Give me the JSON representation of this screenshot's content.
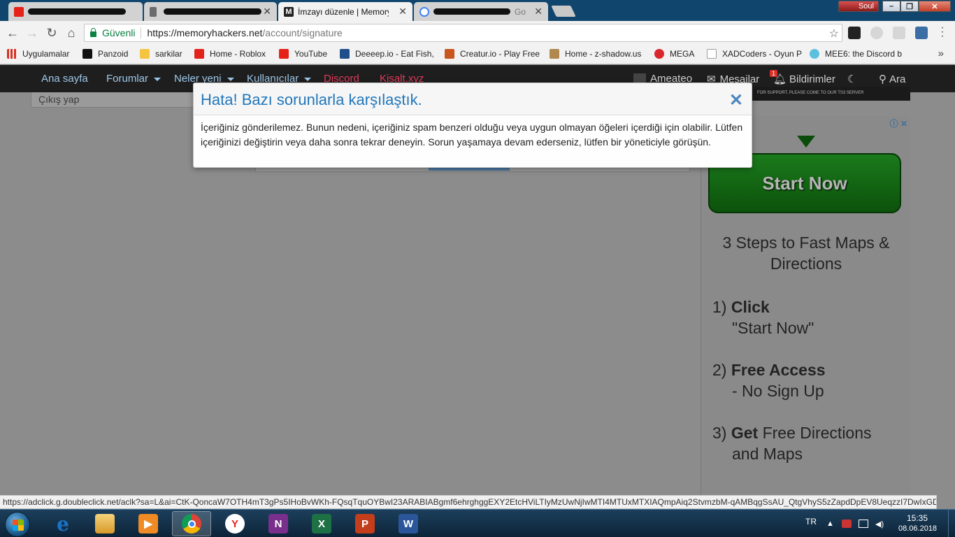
{
  "tabs": [
    {
      "title": "",
      "favicon_color": "#e62117"
    },
    {
      "title": "",
      "favicon_color": "#6b6b6b"
    },
    {
      "title": "İmzayı düzenle | Memory",
      "favicon_color": "#222222"
    },
    {
      "title": "Go",
      "favicon_color": "#4285f4"
    }
  ],
  "profile_name": "Soul",
  "address_bar": {
    "secure_label": "Güvenli",
    "url_host": "https://memoryhackers.net",
    "url_path": "/account/signature"
  },
  "bookmarks": [
    {
      "label": "Uygulamalar",
      "icon": "apps-grid-icon",
      "color": "#d93025"
    },
    {
      "label": "Panzoid",
      "icon": "panzoid-icon",
      "color": "#111111"
    },
    {
      "label": "sarkilar",
      "icon": "folder-icon",
      "color": "#f5c542"
    },
    {
      "label": "Home - Roblox",
      "icon": "roblox-icon",
      "color": "#e2231a"
    },
    {
      "label": "YouTube",
      "icon": "youtube-icon",
      "color": "#e62117"
    },
    {
      "label": "Deeeep.io - Eat Fish,",
      "icon": "deeeep-icon",
      "color": "#1e4f8a"
    },
    {
      "label": "Creatur.io - Play Free",
      "icon": "creatur-icon",
      "color": "#c8561e"
    },
    {
      "label": "Home - z-shadow.us",
      "icon": "zshadow-icon",
      "color": "#b08850"
    },
    {
      "label": "MEGA",
      "icon": "mega-icon",
      "color": "#d9272e"
    },
    {
      "label": "XADCoders - Oyun P",
      "icon": "page-icon",
      "color": "#9e9e9e"
    },
    {
      "label": "MEE6: the Discord b",
      "icon": "mee6-icon",
      "color": "#5bc0de"
    }
  ],
  "sitenav": {
    "items": [
      "Ana sayfa",
      "Forumlar",
      "Neler yeni",
      "Kullanıcılar"
    ],
    "red_items": [
      "Discord",
      "Kisalt.xyz"
    ],
    "username": "Ameateo",
    "messages": "Mesajlar",
    "notifications": "Bildirimler",
    "notification_count": "1",
    "search": "Ara"
  },
  "sidebar": {
    "logout": "Çıkış yap"
  },
  "banner_text": "FOR SUPPORT, PLEASE COME TO OUR TS3 SERVER",
  "modal": {
    "title": "Hata! Bazı sorunlarla karşılaştık.",
    "message": "İçeriğiniz gönderilemez. Bunun nedeni, içeriğiniz spam benzeri olduğu veya uygun olmayan öğeleri içerdiği için olabilir. Lütfen içeriğinizi değiştirin veya daha sonra tekrar deneyin. Sorun yaşamaya devam ederseniz, lütfen bir yöneticiyle görüşün."
  },
  "ad": {
    "button": "Start Now",
    "heading": "3 Steps to Fast Maps & Directions",
    "steps": [
      {
        "num": "1)",
        "bold": "Click",
        "rest": "\"Start Now\""
      },
      {
        "num": "2)",
        "bold": "Free Access",
        "rest": "- No Sign Up"
      },
      {
        "num": "3)",
        "bold": "Get",
        "rest1": " Free Directions",
        "rest2": "and Maps"
      }
    ]
  },
  "status_url": "https://adclick.g.doubleclick.net/aclk?sa=L&ai=CtK-QoncaW7OTH4mT3gPs5IHoBvWKh-FQsqTquOYBwI23ARABIABgmf6ehrghggEXY2EtcHViLTIyMzUwNjIwMTI4MTUxMTXIAQmpAiq2StvmzbM-qAMBqgSsAU_QtgVhyS5zZapdDpEV8UeqzzI7DwIxGDHvY3...",
  "taskbar": {
    "language": "TR",
    "time": "15:35",
    "date": "08.06.2018",
    "apps": [
      {
        "name": "internet-explorer",
        "letter": "e",
        "color": "#1a73c8"
      },
      {
        "name": "file-explorer",
        "letter": "",
        "color": "#e8b84a"
      },
      {
        "name": "media-player",
        "letter": "▶",
        "color": "#f08a24"
      },
      {
        "name": "chrome",
        "letter": "",
        "color": "#4285f4"
      },
      {
        "name": "yandex",
        "letter": "Y",
        "color": "#ffffff"
      },
      {
        "name": "onenote",
        "letter": "N",
        "color": "#7a2f8c"
      },
      {
        "name": "excel",
        "letter": "X",
        "color": "#1e7145"
      },
      {
        "name": "powerpoint",
        "letter": "P",
        "color": "#c43e1c"
      },
      {
        "name": "word",
        "letter": "W",
        "color": "#2b579a"
      }
    ]
  }
}
